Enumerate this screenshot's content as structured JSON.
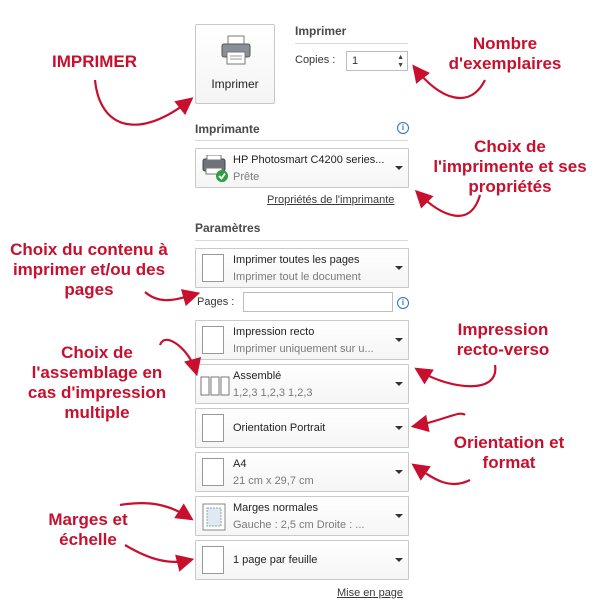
{
  "print": {
    "button_label": "Imprimer",
    "section_title": "Imprimer",
    "copies_label": "Copies :",
    "copies_value": "1"
  },
  "printer": {
    "section_title": "Imprimante",
    "name": "HP Photosmart C4200 series...",
    "status": "Prête",
    "properties_link": "Propriétés de l'imprimante"
  },
  "settings": {
    "section_title": "Paramètres",
    "pages_label": "Pages :",
    "pages_value": "",
    "dropdowns": [
      {
        "title": "Imprimer toutes les pages",
        "subtitle": "Imprimer tout le document",
        "icon": "pages-icon"
      },
      {
        "title": "Impression recto",
        "subtitle": "Imprimer uniquement sur u...",
        "icon": "one-side-icon"
      },
      {
        "title": "Assemblé",
        "subtitle": "1,2,3    1,2,3    1,2,3",
        "icon": "collate-icon"
      },
      {
        "title": "Orientation Portrait",
        "subtitle": "",
        "icon": "portrait-icon"
      },
      {
        "title": "A4",
        "subtitle": "21 cm x 29,7 cm",
        "icon": "paper-size-icon"
      },
      {
        "title": "Marges normales",
        "subtitle": "Gauche : 2,5 cm    Droite : ...",
        "icon": "margins-icon"
      },
      {
        "title": "1 page par feuille",
        "subtitle": "",
        "icon": "pages-per-sheet-icon"
      }
    ],
    "page_setup_link": "Mise en page"
  },
  "annotations": {
    "imprimer": "IMPRIMER",
    "copies": "Nombre d'exemplaires",
    "printer": "Choix de l'imprimente et ses propriétés",
    "content": "Choix du contenu à imprimer et/ou des pages",
    "collate": "Choix de l'assemblage en cas d'impression multiple",
    "duplex": "Impression recto-verso",
    "orientation": "Orientation et format",
    "margins": "Marges et échelle"
  },
  "colors": {
    "annotation": "#c8102e",
    "info_icon": "#2e6fc3"
  }
}
